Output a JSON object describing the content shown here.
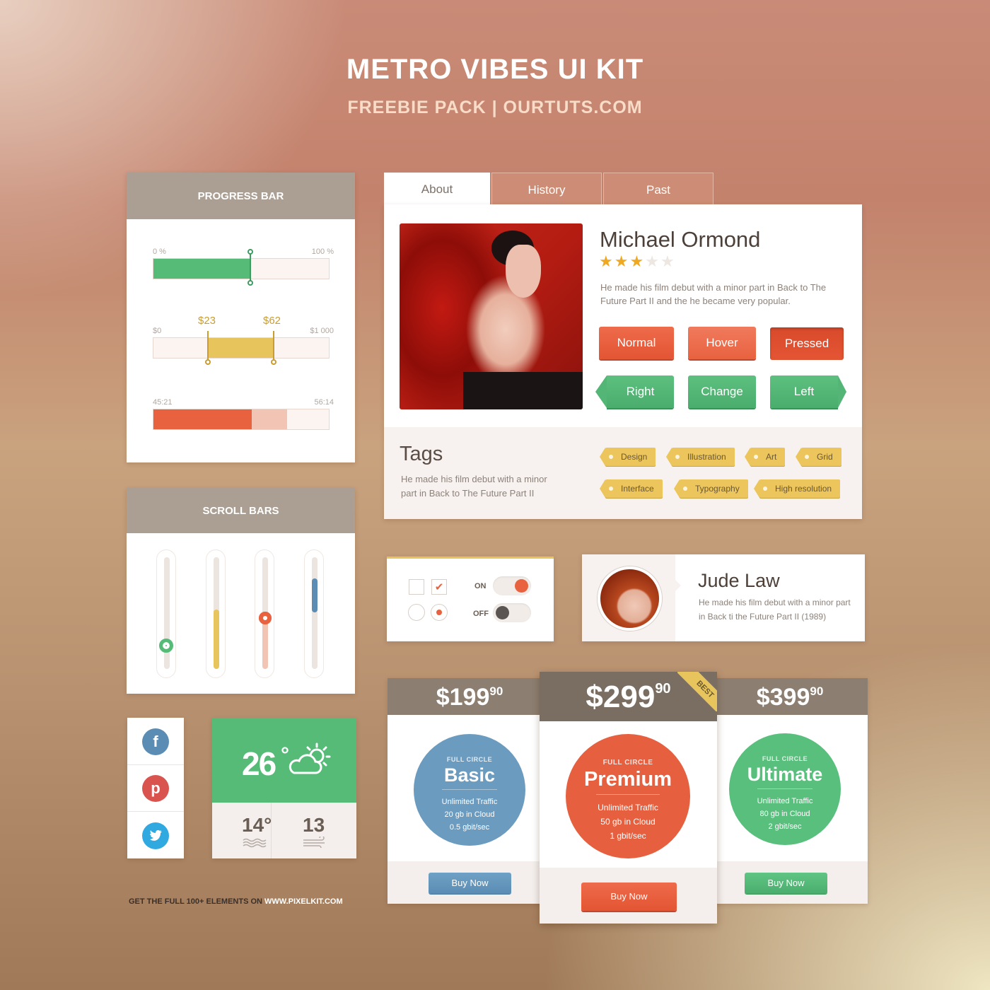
{
  "header": {
    "title": "METRO VIBES UI KIT",
    "subtitle": "FREEBIE PACK  |  OURTUTS.COM"
  },
  "progress": {
    "title": "PROGRESS BAR",
    "bar1": {
      "min": "0 %",
      "max": "100 %",
      "value": 0.56
    },
    "bar2": {
      "min": "$0",
      "max": "$1 000",
      "low": "$23",
      "high": "$62"
    },
    "bar3": {
      "start": "45:21",
      "end": "56:14",
      "played": 0.56,
      "buffered": 0.76
    }
  },
  "scroll": {
    "title": "SCROLL BARS"
  },
  "tabs": [
    "About",
    "History",
    "Past"
  ],
  "profile": {
    "name": "Michael Ormond",
    "rating": 3,
    "max_rating": 5,
    "bio": "He made his film debut with a minor part in Back to The Future Part II and the he became very popular.",
    "buttons": {
      "normal": "Normal",
      "hover": "Hover",
      "pressed": "Pressed",
      "right": "Right",
      "change": "Change",
      "left": "Left"
    }
  },
  "tags": {
    "title": "Tags",
    "text": "He made his film debut with a minor part in Back to The Future Part II",
    "items": [
      "Design",
      "Illustration",
      "Art",
      "Grid",
      "Interface",
      "Typography",
      "High resolution"
    ]
  },
  "toggles": {
    "on": "ON",
    "off": "OFF"
  },
  "person": {
    "name": "Jude Law",
    "bio": "He made his film debut with a minor part in Back ti the Future Part II (1989)"
  },
  "weather": {
    "temp": "26",
    "deg": "°",
    "low": "14°",
    "wind": "13"
  },
  "footer": {
    "prefix": "GET THE FULL 100+ ELEMENTS ON ",
    "link": "WWW.PIXELKIT.COM"
  },
  "pricing": [
    {
      "price": "$199",
      "cents": "90",
      "label": "FULL CIRCLE",
      "name": "Basic",
      "features": [
        "Unlimited Traffic",
        "20 gb in Cloud",
        "0.5 gbit/sec"
      ],
      "buy": "Buy Now",
      "color": "#6b9bbf"
    },
    {
      "price": "$299",
      "cents": "90",
      "label": "FULL CIRCLE",
      "name": "Premium",
      "features": [
        "Unlimited Traffic",
        "50 gb in Cloud",
        "1 gbit/sec"
      ],
      "buy": "Buy Now",
      "color": "#e65f3f",
      "badge": "BEST"
    },
    {
      "price": "$399",
      "cents": "90",
      "label": "FULL CIRCLE",
      "name": "Ultimate",
      "features": [
        "Unlimited Traffic",
        "80 gb in Cloud",
        "2 gbit/sec"
      ],
      "buy": "Buy Now",
      "color": "#58bf7d"
    }
  ],
  "colors": {
    "green": "#56bb77",
    "yellow": "#e8c55c",
    "orange": "#e8623f",
    "blue": "#5b8db4",
    "panel_head": "#ab9f93"
  }
}
